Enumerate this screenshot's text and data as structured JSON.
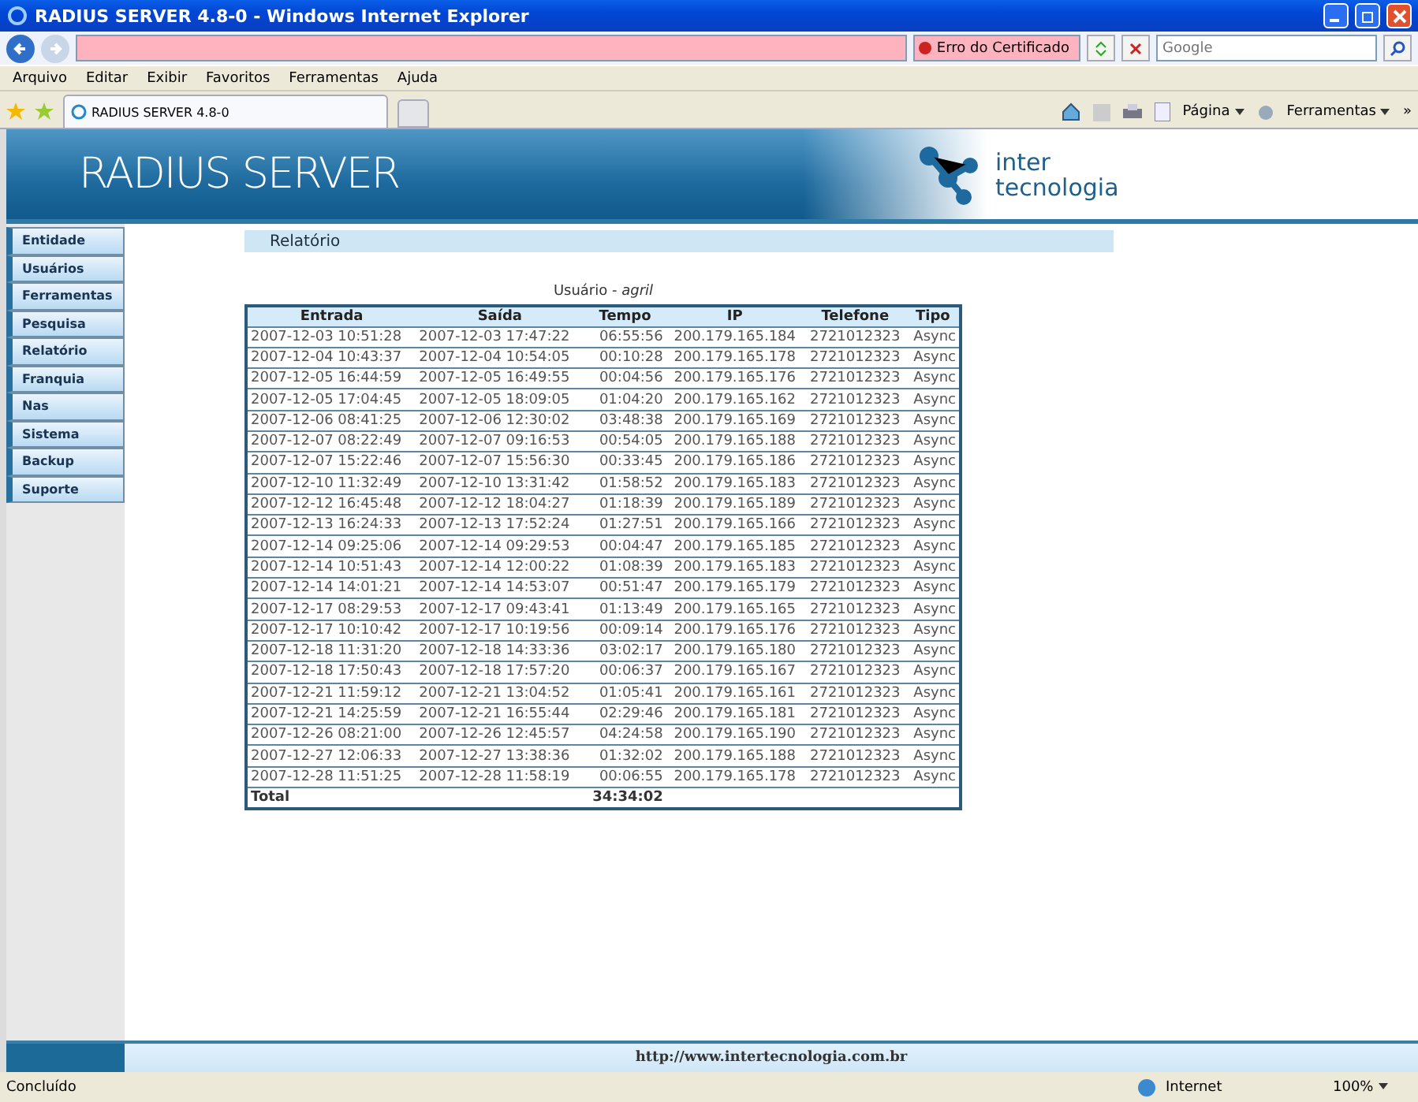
{
  "window": {
    "title": "RADIUS SERVER 4.8-0 - Windows Internet Explorer"
  },
  "address_bar": {
    "certificate_error": "Erro do Certificado",
    "search_placeholder": "Google"
  },
  "menu": [
    "Arquivo",
    "Editar",
    "Exibir",
    "Favoritos",
    "Ferramentas",
    "Ajuda"
  ],
  "tab": {
    "title": "RADIUS SERVER 4.8-0"
  },
  "command_bar": {
    "page": "Página",
    "tools": "Ferramentas",
    "more": "»"
  },
  "banner": {
    "title": "RADIUS SERVER",
    "logo_top": "inter",
    "logo_bottom": "tecnologia"
  },
  "sidebar": {
    "items": [
      "Entidade",
      "Usuários",
      "Ferramentas",
      "Pesquisa",
      "Relatório",
      "Franquia",
      "Nas",
      "Sistema",
      "Backup",
      "Suporte"
    ]
  },
  "section_title": "Relatório",
  "report": {
    "user_label": "Usuário - ",
    "user": "agril",
    "columns": [
      "Entrada",
      "Saída",
      "Tempo",
      "IP",
      "Telefone",
      "Tipo"
    ],
    "rows": [
      [
        "2007-12-03 10:51:28",
        "2007-12-03 17:47:22",
        "06:55:56",
        "200.179.165.184",
        "2721012323",
        "Async"
      ],
      [
        "2007-12-04 10:43:37",
        "2007-12-04 10:54:05",
        "00:10:28",
        "200.179.165.178",
        "2721012323",
        "Async"
      ],
      [
        "2007-12-05 16:44:59",
        "2007-12-05 16:49:55",
        "00:04:56",
        "200.179.165.176",
        "2721012323",
        "Async"
      ],
      [
        "2007-12-05 17:04:45",
        "2007-12-05 18:09:05",
        "01:04:20",
        "200.179.165.162",
        "2721012323",
        "Async"
      ],
      [
        "2007-12-06 08:41:25",
        "2007-12-06 12:30:02",
        "03:48:38",
        "200.179.165.169",
        "2721012323",
        "Async"
      ],
      [
        "2007-12-07 08:22:49",
        "2007-12-07 09:16:53",
        "00:54:05",
        "200.179.165.188",
        "2721012323",
        "Async"
      ],
      [
        "2007-12-07 15:22:46",
        "2007-12-07 15:56:30",
        "00:33:45",
        "200.179.165.186",
        "2721012323",
        "Async"
      ],
      [
        "2007-12-10 11:32:49",
        "2007-12-10 13:31:42",
        "01:58:52",
        "200.179.165.183",
        "2721012323",
        "Async"
      ],
      [
        "2007-12-12 16:45:48",
        "2007-12-12 18:04:27",
        "01:18:39",
        "200.179.165.189",
        "2721012323",
        "Async"
      ],
      [
        "2007-12-13 16:24:33",
        "2007-12-13 17:52:24",
        "01:27:51",
        "200.179.165.166",
        "2721012323",
        "Async"
      ],
      [
        "2007-12-14 09:25:06",
        "2007-12-14 09:29:53",
        "00:04:47",
        "200.179.165.185",
        "2721012323",
        "Async"
      ],
      [
        "2007-12-14 10:51:43",
        "2007-12-14 12:00:22",
        "01:08:39",
        "200.179.165.183",
        "2721012323",
        "Async"
      ],
      [
        "2007-12-14 14:01:21",
        "2007-12-14 14:53:07",
        "00:51:47",
        "200.179.165.179",
        "2721012323",
        "Async"
      ],
      [
        "2007-12-17 08:29:53",
        "2007-12-17 09:43:41",
        "01:13:49",
        "200.179.165.165",
        "2721012323",
        "Async"
      ],
      [
        "2007-12-17 10:10:42",
        "2007-12-17 10:19:56",
        "00:09:14",
        "200.179.165.176",
        "2721012323",
        "Async"
      ],
      [
        "2007-12-18 11:31:20",
        "2007-12-18 14:33:36",
        "03:02:17",
        "200.179.165.180",
        "2721012323",
        "Async"
      ],
      [
        "2007-12-18 17:50:43",
        "2007-12-18 17:57:20",
        "00:06:37",
        "200.179.165.167",
        "2721012323",
        "Async"
      ],
      [
        "2007-12-21 11:59:12",
        "2007-12-21 13:04:52",
        "01:05:41",
        "200.179.165.161",
        "2721012323",
        "Async"
      ],
      [
        "2007-12-21 14:25:59",
        "2007-12-21 16:55:44",
        "02:29:46",
        "200.179.165.181",
        "2721012323",
        "Async"
      ],
      [
        "2007-12-26 08:21:00",
        "2007-12-26 12:45:57",
        "04:24:58",
        "200.179.165.190",
        "2721012323",
        "Async"
      ],
      [
        "2007-12-27 12:06:33",
        "2007-12-27 13:38:36",
        "01:32:02",
        "200.179.165.188",
        "2721012323",
        "Async"
      ],
      [
        "2007-12-28 11:51:25",
        "2007-12-28 11:58:19",
        "00:06:55",
        "200.179.165.178",
        "2721012323",
        "Async"
      ]
    ],
    "total_label": "Total",
    "total": "34:34:02"
  },
  "footer": {
    "url": "http://www.intertecnologia.com.br"
  },
  "status_bar": {
    "status": "Concluído",
    "zone": "Internet",
    "zoom": "100%"
  }
}
